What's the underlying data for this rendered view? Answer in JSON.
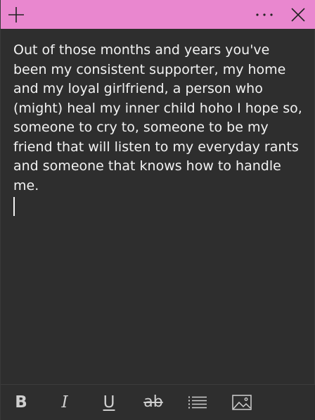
{
  "titlebar": {
    "color": "#e987cf",
    "add_icon": "plus-icon",
    "more_icon": "ellipsis-icon",
    "close_icon": "close-icon"
  },
  "note": {
    "text": "Out of those months and years you've been my consistent supporter, my home and my loyal girlfriend, a person who (might) heal my inner child hoho I hope so, someone to cry to, someone to be my friend that will listen to my everyday rants and someone that knows how to handle me."
  },
  "toolbar": {
    "bold_label": "B",
    "italic_label": "I",
    "underline_label": "U",
    "strike_label": "ab",
    "list_icon": "bullet-list-icon",
    "image_icon": "image-icon"
  }
}
